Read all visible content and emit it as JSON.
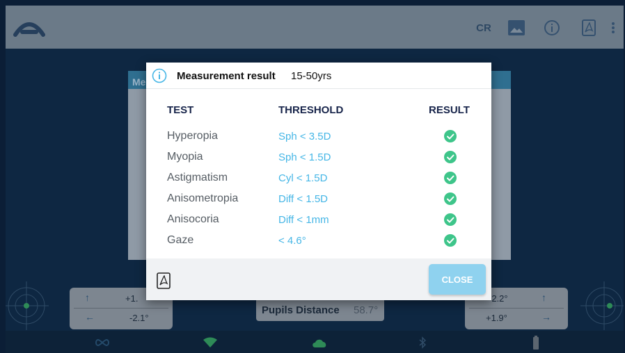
{
  "toolbar": {
    "cr_label": "CR",
    "icons": [
      "app-logo-icon",
      "image-icon",
      "info-icon",
      "pdf-icon",
      "more-vert-icon"
    ]
  },
  "background": {
    "panel_label": "Me",
    "left_offsets": {
      "up_value": "+1.",
      "left_value": "-2.1°"
    },
    "right_offsets": {
      "up_value": "-2.2°",
      "right_value": "+1.9°"
    },
    "pupils_distance": {
      "label": "Pupils Distance",
      "value": "58.7°"
    }
  },
  "bottom_bar": {
    "icons": [
      "infinity-icon",
      "wifi-icon",
      "cloud-icon",
      "bluetooth-icon",
      "battery-icon"
    ]
  },
  "dialog": {
    "title": "Measurement result",
    "subtitle": "15-50yrs",
    "columns": {
      "test": "TEST",
      "threshold": "THRESHOLD",
      "result": "RESULT"
    },
    "rows": [
      {
        "test": "Hyperopia",
        "threshold": "Sph < 3.5D",
        "result": "pass"
      },
      {
        "test": "Myopia",
        "threshold": "Sph < 1.5D",
        "result": "pass"
      },
      {
        "test": "Astigmatism",
        "threshold": "Cyl < 1.5D",
        "result": "pass"
      },
      {
        "test": "Anisometropia",
        "threshold": "Diff < 1.5D",
        "result": "pass"
      },
      {
        "test": "Anisocoria",
        "threshold": "Diff < 1mm",
        "result": "pass"
      },
      {
        "test": "Gaze",
        "threshold": "< 4.6°",
        "result": "pass"
      }
    ],
    "close_label": "CLOSE"
  },
  "colors": {
    "accent": "#45b6e6",
    "pass": "#3ec58a",
    "close_button": "#8fd2ef",
    "header_text": "#17244a"
  }
}
